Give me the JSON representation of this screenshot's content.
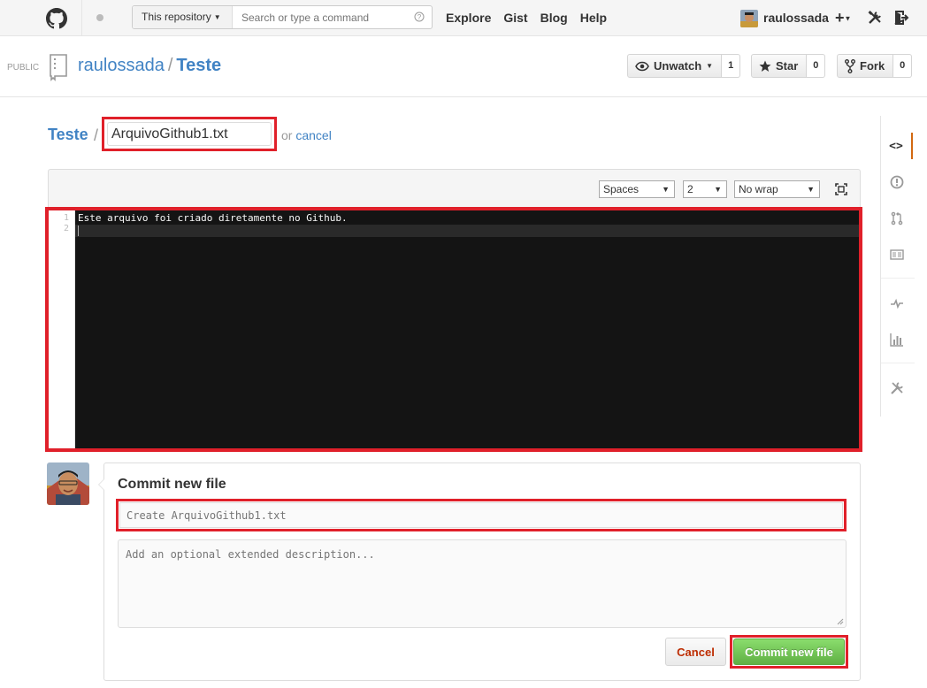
{
  "header": {
    "scope_label": "This repository",
    "search_placeholder": "Search or type a command",
    "nav": [
      "Explore",
      "Gist",
      "Blog",
      "Help"
    ],
    "username": "raulossada",
    "plus": "+"
  },
  "repo": {
    "visibility": "PUBLIC",
    "owner": "raulossada",
    "separator": "/",
    "name": "Teste",
    "unwatch_label": "Unwatch",
    "watch_count": "1",
    "star_label": "Star",
    "star_count": "0",
    "fork_label": "Fork",
    "fork_count": "0"
  },
  "file": {
    "breadcrumb_repo": "Teste",
    "separator": "/",
    "filename": "ArquivoGithub1.txt",
    "or_text": "or ",
    "cancel_link": "cancel"
  },
  "editor": {
    "indent_mode": "Spaces",
    "indent_size": "2",
    "wrap_mode": "No wrap",
    "lines": [
      {
        "number": "1",
        "text": "Este arquivo foi criado diretamente no Github."
      },
      {
        "number": "2",
        "text": ""
      }
    ]
  },
  "commit": {
    "title": "Commit new file",
    "summary_placeholder": "Create ArquivoGithub1.txt",
    "description_placeholder": "Add an optional extended description...",
    "cancel_label": "Cancel",
    "submit_label": "Commit new file"
  },
  "sidebar": {
    "items": [
      "code-icon",
      "issues-icon",
      "pull-requests-icon",
      "wiki-icon",
      "pulse-icon",
      "graphs-icon",
      "settings-icon"
    ],
    "selected": "code-icon"
  },
  "colors": {
    "link": "#4183c4",
    "highlight_border": "#e0202a",
    "commit_green": "#60b044",
    "selected_tab": "#d26911"
  }
}
